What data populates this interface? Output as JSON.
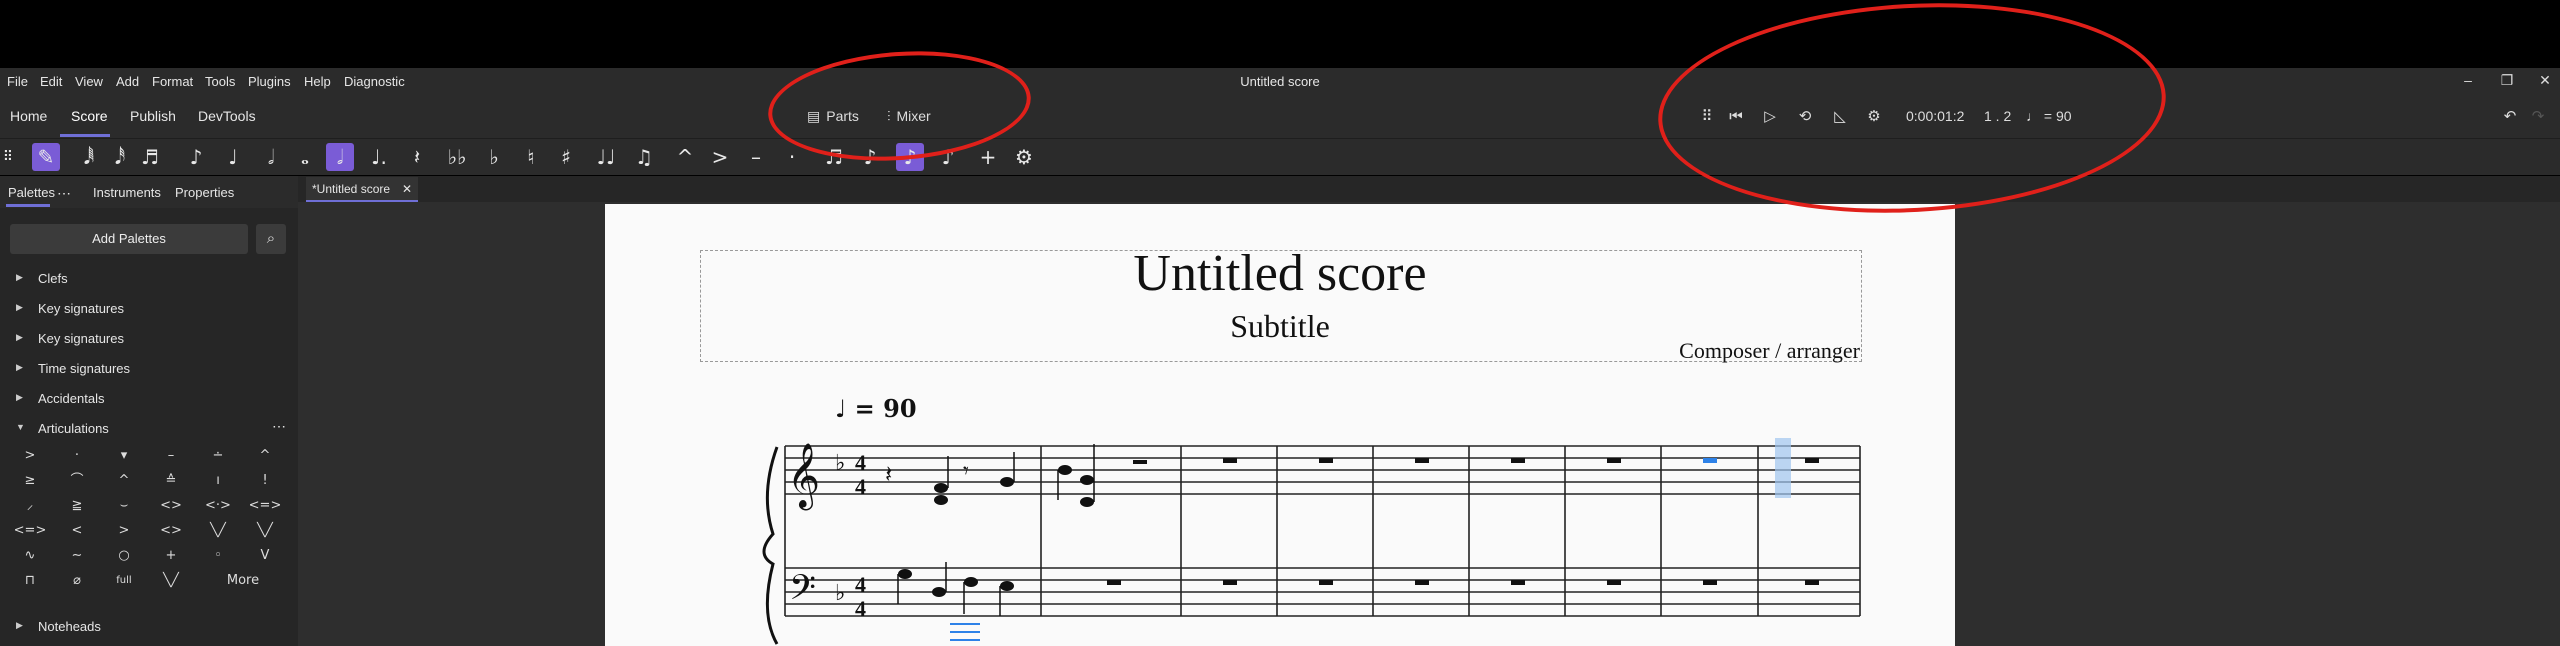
{
  "window": {
    "title": "Untitled score"
  },
  "menubar": [
    "File",
    "Edit",
    "View",
    "Add",
    "Format",
    "Tools",
    "Plugins",
    "Help",
    "Diagnostic"
  ],
  "tabs": [
    "Home",
    "Score",
    "Publish",
    "DevTools"
  ],
  "active_tab": "Score",
  "parts_button": "Parts",
  "mixer_button": "Mixer",
  "playback": {
    "time": "0:00:01:2",
    "position": "1 . 2",
    "tempo": "♩ = 90"
  },
  "panel_tabs": [
    "Palettes",
    "Instruments",
    "Properties"
  ],
  "add_palettes": "Add Palettes",
  "palettes": [
    "Clefs",
    "Key signatures",
    "Key signatures",
    "Time signatures",
    "Accidentals",
    "Articulations",
    "Noteheads"
  ],
  "articulation_more": "More",
  "doc_tab": "*Untitled score",
  "score": {
    "title": "Untitled score",
    "subtitle": "Subtitle",
    "composer": "Composer / arranger",
    "tempo_mark": "♩ = 90"
  },
  "colors": {
    "accent": "#7a5cd6",
    "annotation": "#e0201a",
    "selection": "#2e82e8"
  }
}
